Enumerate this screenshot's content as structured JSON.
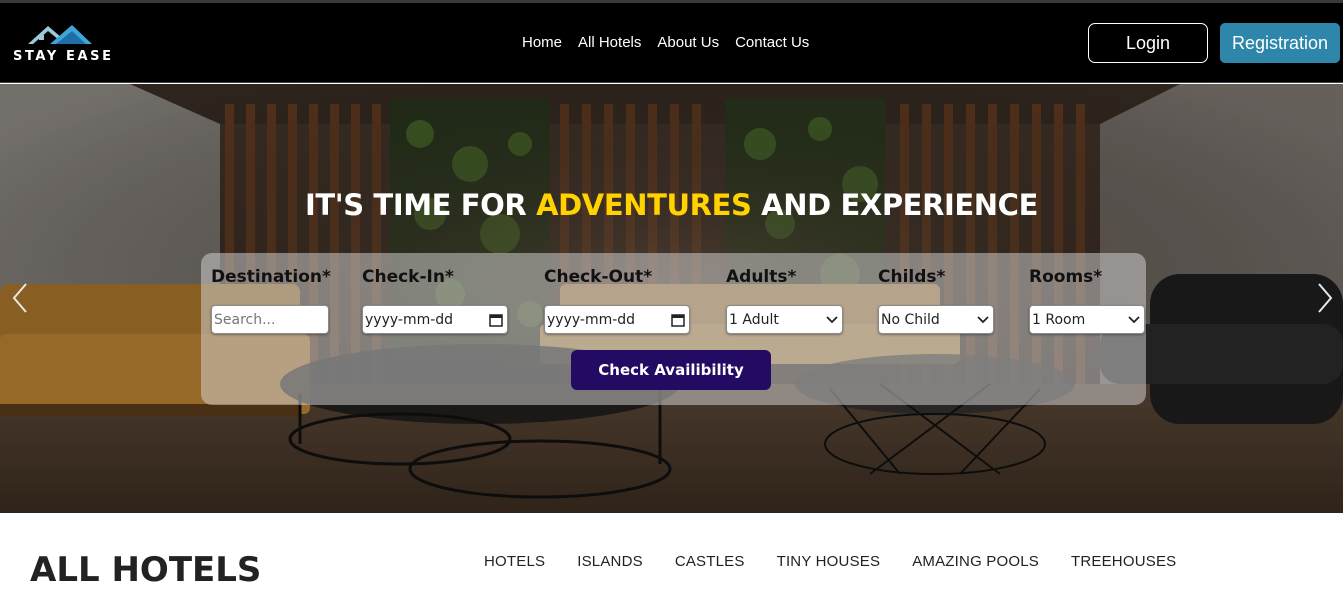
{
  "brand": {
    "name": "STAY EASE",
    "logo_icon": "house-roof-icon"
  },
  "nav": {
    "links": [
      "Home",
      "All Hotels",
      "About Us",
      "Contact Us"
    ]
  },
  "auth": {
    "login_label": "Login",
    "register_label": "Registration"
  },
  "hero": {
    "title_prefix": "IT'S TIME FOR ",
    "title_accent": "ADVENTURES",
    "title_suffix": " AND EXPERIENCE"
  },
  "search": {
    "destination": {
      "label": "Destination*",
      "placeholder": "Search..."
    },
    "checkin": {
      "label": "Check-In*",
      "placeholder": "yyyy-mm-dd"
    },
    "checkout": {
      "label": "Check-Out*",
      "placeholder": "yyyy-mm-dd"
    },
    "adults": {
      "label": "Adults*",
      "value": "1 Adult"
    },
    "childs": {
      "label": "Childs*",
      "value": "No Child"
    },
    "rooms": {
      "label": "Rooms*",
      "value": "1 Room"
    },
    "submit_label": "Check Availibility"
  },
  "hotels_section": {
    "title": "ALL HOTELS",
    "categories": [
      "HOTELS",
      "ISLANDS",
      "CASTLES",
      "TINY HOUSES",
      "AMAZING POOLS",
      "TREEHOUSES"
    ]
  },
  "colors": {
    "accent_yellow": "#ffd200",
    "brand_blue": "#2e86ab",
    "submit_navy": "#230a63",
    "nav_bg": "#000000"
  }
}
